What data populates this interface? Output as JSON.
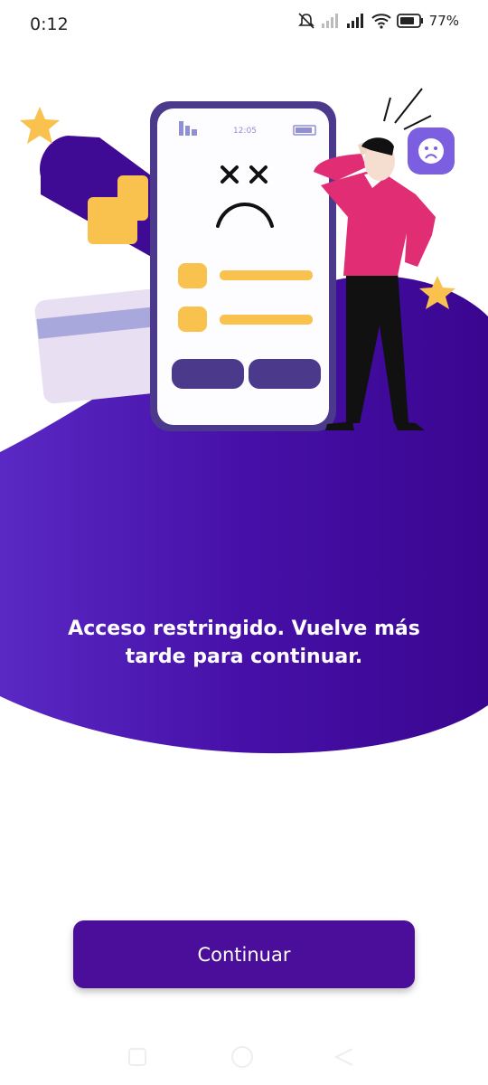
{
  "status_bar": {
    "time": "0:12",
    "battery_percent": "77%",
    "icons": [
      "mute-bell-icon",
      "signal-icon",
      "signal-icon",
      "wifi-icon",
      "battery-icon"
    ]
  },
  "illustration": {
    "phone_time": "12:05"
  },
  "message": {
    "text": "Acceso restringido. Vuelve más tarde para continuar."
  },
  "continue_button": {
    "label": "Continuar"
  },
  "colors": {
    "primary_purple": "#4a0e9a",
    "blob_purple": "#3d0a96",
    "accent_yellow": "#f9c14e",
    "accent_pink": "#e02d73"
  },
  "nav_bar": {
    "icons": [
      "recent-apps-icon",
      "home-icon",
      "back-icon"
    ]
  }
}
